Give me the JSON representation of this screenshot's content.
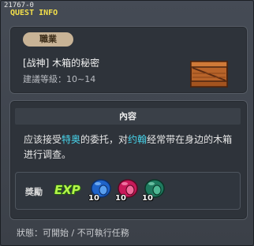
{
  "header": {
    "quest_id": "21767-0",
    "title": "QUEST INFO"
  },
  "quest": {
    "category_badge": "職業",
    "name": "[战神] 木箱的秘密",
    "level_req": "建議等級：10~14",
    "icon": "wooden-crate-icon"
  },
  "content": {
    "section_title": "內容",
    "desc_part1": "应该接受",
    "desc_name1": "特奥",
    "desc_part2": "的委托，对",
    "desc_name2": "约翰",
    "desc_part3": "经常带在身边的木箱进行调查。",
    "highlight_color": "#48d7ee"
  },
  "rewards": {
    "label": "獎勵",
    "exp_label": "EXP",
    "items": [
      {
        "icon": "blue-helmet-icon",
        "count": "10",
        "color": "#1f63c9"
      },
      {
        "icon": "magenta-helmet-icon",
        "count": "10",
        "color": "#c81a5a"
      },
      {
        "icon": "green-helmet-icon",
        "count": "10",
        "color": "#1f7a5f"
      }
    ]
  },
  "status": {
    "text": "狀態：可開始 / 不可執行任務"
  }
}
